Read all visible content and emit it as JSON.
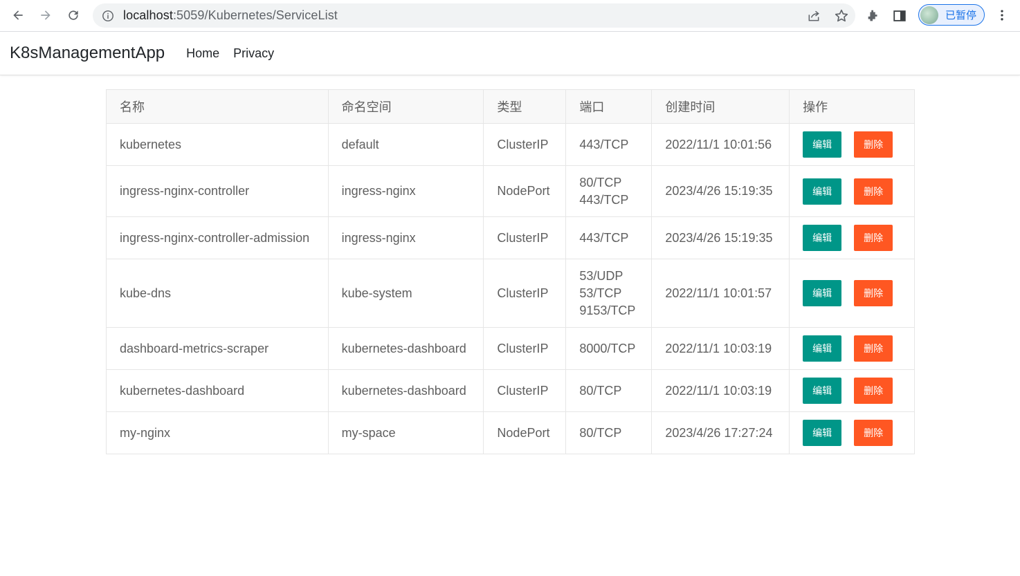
{
  "browser": {
    "url_host": "localhost",
    "url_path": ":5059/Kubernetes/ServiceList",
    "profile_label": "已暂停"
  },
  "navbar": {
    "brand": "K8sManagementApp",
    "links": [
      "Home",
      "Privacy"
    ]
  },
  "table": {
    "headers": [
      "名称",
      "命名空间",
      "类型",
      "端口",
      "创建时间",
      "操作"
    ],
    "edit_label": "编辑",
    "delete_label": "删除",
    "rows": [
      {
        "name": "kubernetes",
        "namespace": "default",
        "type": "ClusterIP",
        "ports": [
          "443/TCP"
        ],
        "created": "2022/11/1 10:01:56"
      },
      {
        "name": "ingress-nginx-controller",
        "namespace": "ingress-nginx",
        "type": "NodePort",
        "ports": [
          "80/TCP",
          "443/TCP"
        ],
        "created": "2023/4/26 15:19:35"
      },
      {
        "name": "ingress-nginx-controller-admission",
        "namespace": "ingress-nginx",
        "type": "ClusterIP",
        "ports": [
          "443/TCP"
        ],
        "created": "2023/4/26 15:19:35"
      },
      {
        "name": "kube-dns",
        "namespace": "kube-system",
        "type": "ClusterIP",
        "ports": [
          "53/UDP",
          "53/TCP",
          "9153/TCP"
        ],
        "created": "2022/11/1 10:01:57"
      },
      {
        "name": "dashboard-metrics-scraper",
        "namespace": "kubernetes-dashboard",
        "type": "ClusterIP",
        "ports": [
          "8000/TCP"
        ],
        "created": "2022/11/1 10:03:19"
      },
      {
        "name": "kubernetes-dashboard",
        "namespace": "kubernetes-dashboard",
        "type": "ClusterIP",
        "ports": [
          "80/TCP"
        ],
        "created": "2022/11/1 10:03:19"
      },
      {
        "name": "my-nginx",
        "namespace": "my-space",
        "type": "NodePort",
        "ports": [
          "80/TCP"
        ],
        "created": "2023/4/26 17:27:24"
      }
    ]
  },
  "colors": {
    "edit_button": "#009688",
    "delete_button": "#ff5722",
    "profile_accent": "#1a73e8"
  }
}
